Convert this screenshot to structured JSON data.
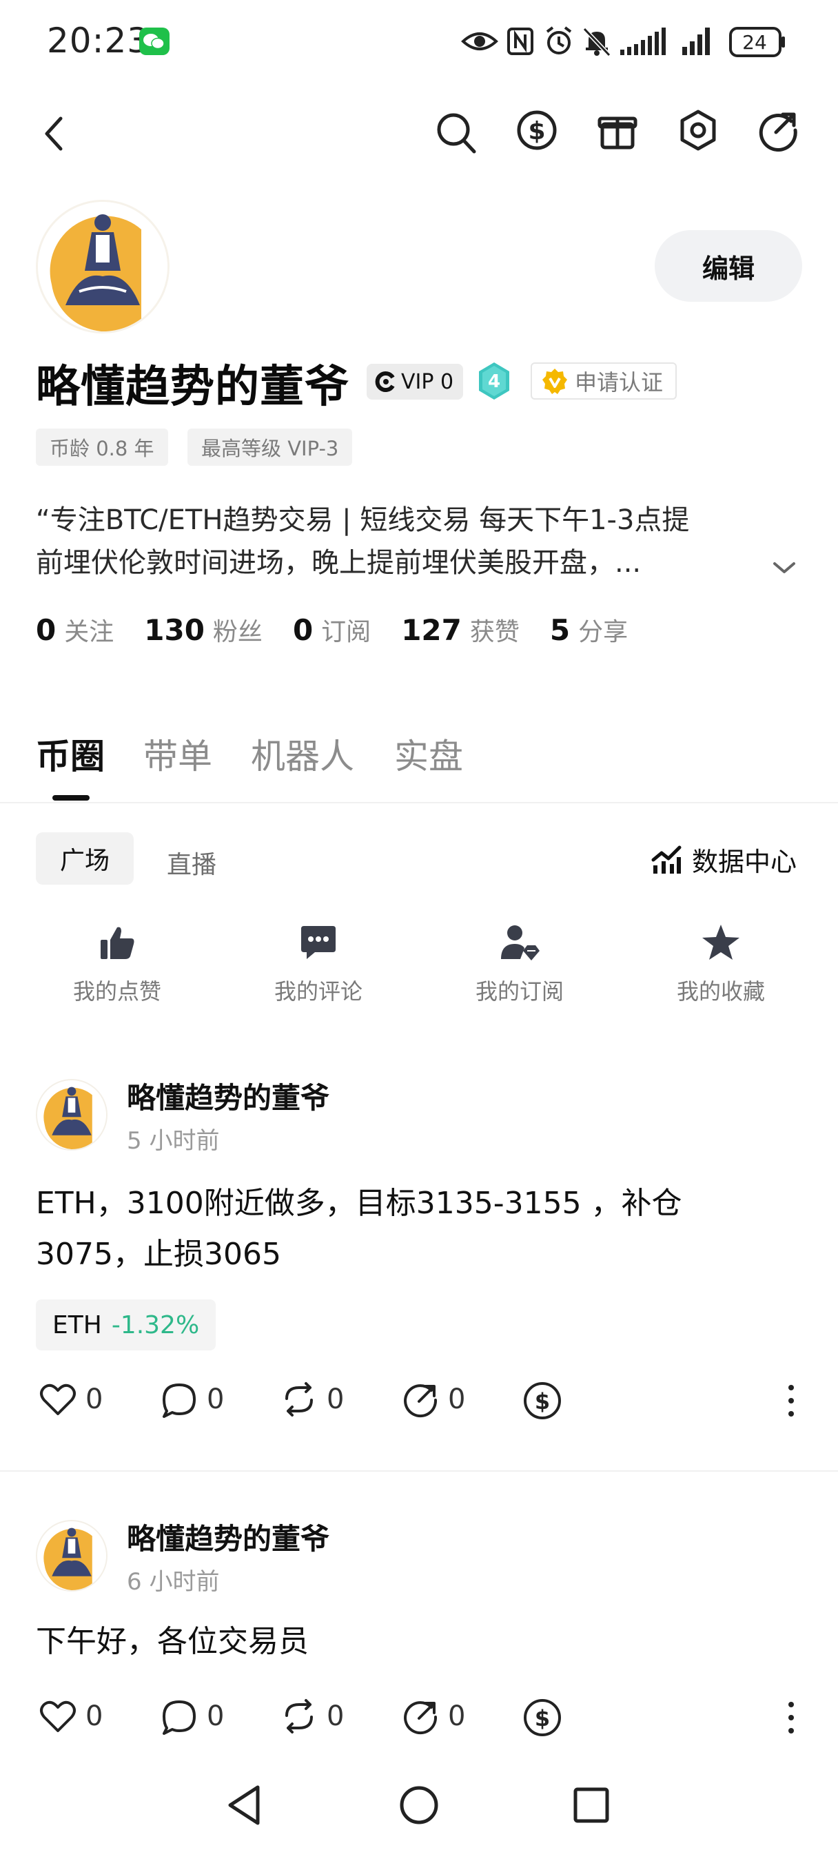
{
  "status_bar": {
    "time": "20:23",
    "battery": "24"
  },
  "profile": {
    "username": "略懂趋势的董爷",
    "vip_label": "VIP 0",
    "level": "4",
    "certify_label": "申请认证",
    "edit_label": "编辑",
    "tags": [
      "币龄 0.8 年",
      "最高等级 VIP-3"
    ],
    "bio_line1": "“专注BTC/ETH趋势交易 | 短线交易 每天下午1-3点提",
    "bio_line2": "前埋伏伦敦时间进场，晚上提前埋伏美股开盘，...",
    "stats": [
      {
        "value": "0",
        "label": "关注"
      },
      {
        "value": "130",
        "label": "粉丝"
      },
      {
        "value": "0",
        "label": "订阅"
      },
      {
        "value": "127",
        "label": "获赞"
      },
      {
        "value": "5",
        "label": "分享"
      }
    ]
  },
  "main_tabs": [
    "币圈",
    "带单",
    "机器人",
    "实盘"
  ],
  "sub_tabs": [
    "广场",
    "直播"
  ],
  "data_center_label": "数据中心",
  "shortcuts": [
    {
      "label": "我的点赞",
      "icon": "thumbs-up-icon"
    },
    {
      "label": "我的评论",
      "icon": "comment-icon"
    },
    {
      "label": "我的订阅",
      "icon": "subscribe-icon"
    },
    {
      "label": "我的收藏",
      "icon": "star-icon"
    }
  ],
  "posts": [
    {
      "author": "略懂趋势的董爷",
      "time": "5 小时前",
      "text_line1": "ETH，3100附近做多，目标3135-3155 ，补仓",
      "text_line2": "3075，止损3065",
      "coin": "ETH",
      "coin_change": "-1.32%",
      "likes": "0",
      "comments": "0",
      "reposts": "0",
      "shares": "0"
    },
    {
      "author": "略懂趋势的董爷",
      "time": "6 小时前",
      "text_line1": "下午好，各位交易员",
      "likes": "0",
      "comments": "0",
      "reposts": "0",
      "shares": "0"
    }
  ],
  "colors": {
    "accent_green": "#2eb88a",
    "level_teal": "#3ec6c0",
    "cert_gold": "#f5b800",
    "avatar_orange": "#f2b23a",
    "avatar_navy": "#3b4672"
  }
}
